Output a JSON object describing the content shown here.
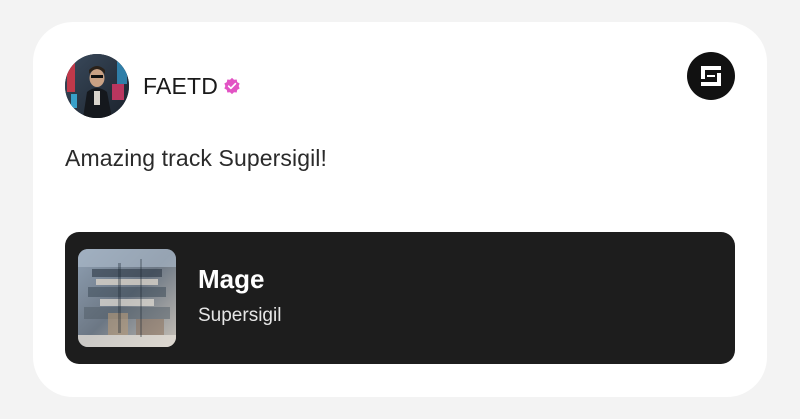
{
  "post": {
    "username": "FAETD",
    "verified": true,
    "comment": "Amazing track Supersigil!"
  },
  "track": {
    "title": "Mage",
    "artist": "Supersigil"
  },
  "icons": {
    "avatar": "user-avatar-photo",
    "verified": "verified-badge-icon",
    "brand": "sound-xyz-logo",
    "album_art": "album-cover-art"
  },
  "colors": {
    "page_background": "#f3f3f3",
    "card_background": "#ffffff",
    "verified_badge": "#e253c4",
    "track_card_background": "#1d1d1d",
    "brand_logo_background": "#111111"
  }
}
